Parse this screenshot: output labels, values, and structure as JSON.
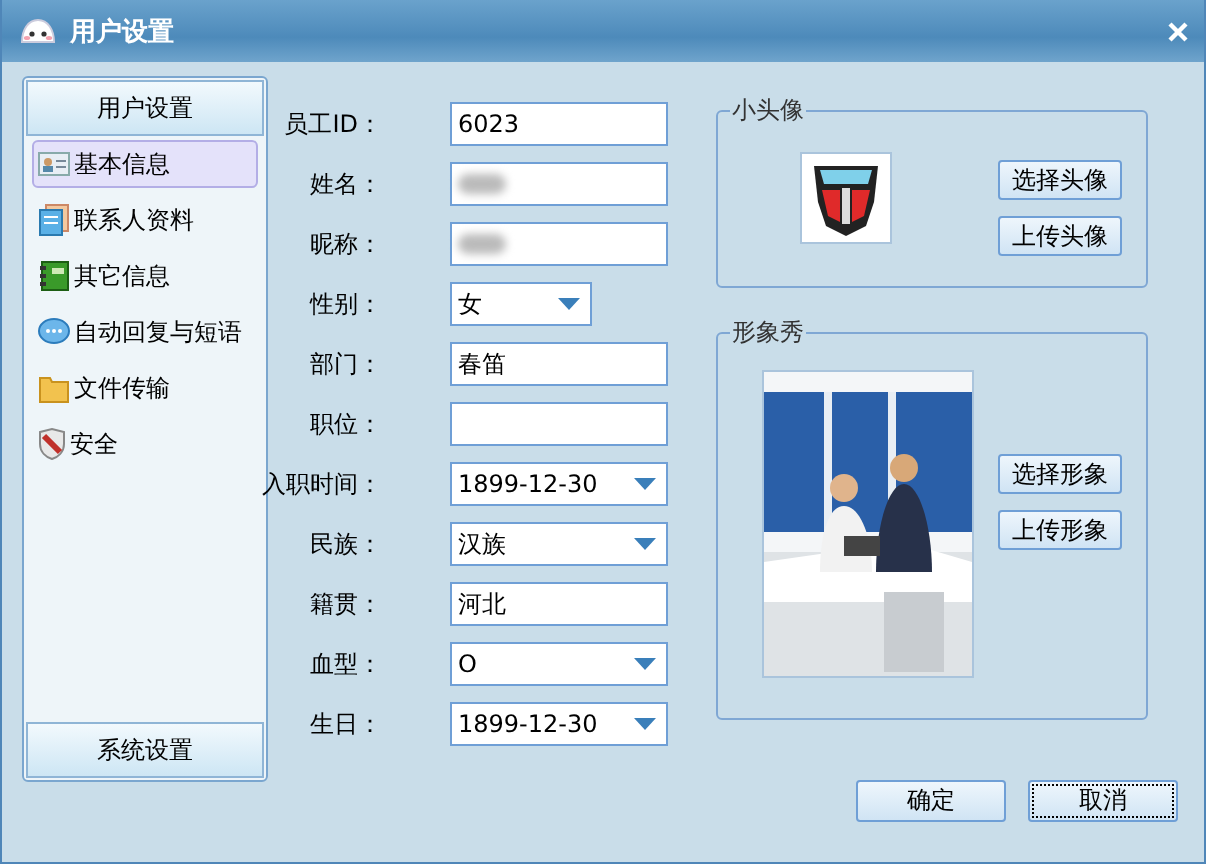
{
  "window": {
    "title": "用户设置"
  },
  "sidebar": {
    "header": "用户设置",
    "footer": "系统设置",
    "items": [
      {
        "label": "基本信息",
        "kind": "card",
        "selected": true
      },
      {
        "label": "联系人资料",
        "kind": "contact",
        "selected": false
      },
      {
        "label": "其它信息",
        "kind": "book",
        "selected": false
      },
      {
        "label": "自动回复与短语",
        "kind": "chat",
        "selected": false
      },
      {
        "label": "文件传输",
        "kind": "folder",
        "selected": false
      },
      {
        "label": "安全",
        "kind": "shield",
        "selected": false
      }
    ]
  },
  "form": {
    "fields": [
      {
        "label": "员工ID：",
        "kind": "text",
        "value": "6023"
      },
      {
        "label": "姓名：",
        "kind": "text",
        "redacted": true
      },
      {
        "label": "昵称：",
        "kind": "text",
        "redacted": true
      },
      {
        "label": "性别：",
        "kind": "short-select",
        "value": "女"
      },
      {
        "label": "部门：",
        "kind": "text",
        "value": "春笛"
      },
      {
        "label": "职位：",
        "kind": "text"
      },
      {
        "label": "入职时间：",
        "kind": "select",
        "value": "1899-12-30"
      },
      {
        "label": "民族：",
        "kind": "select",
        "value": "汉族"
      },
      {
        "label": "籍贯：",
        "kind": "text",
        "value": "河北"
      },
      {
        "label": "血型：",
        "kind": "select",
        "value": "O"
      },
      {
        "label": "生日：",
        "kind": "select",
        "value": "1899-12-30"
      }
    ]
  },
  "avatar": {
    "title": "小头像",
    "buttons": [
      "选择头像",
      "上传头像"
    ]
  },
  "showcase": {
    "title": "形象秀",
    "buttons": [
      "选择形象",
      "上传形象"
    ]
  },
  "buttons": [
    {
      "label": "确定",
      "focused": false
    },
    {
      "label": "取消",
      "focused": true
    }
  ]
}
